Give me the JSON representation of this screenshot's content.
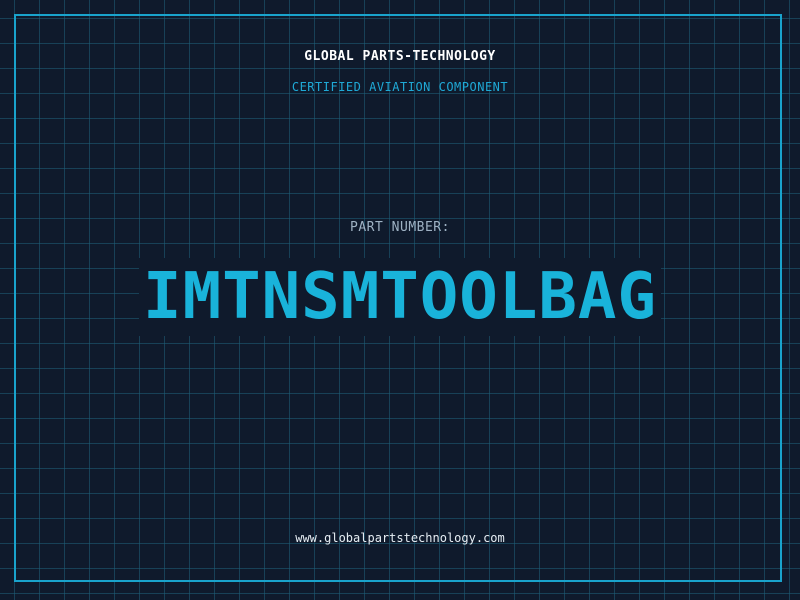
{
  "header": {
    "company": "GLOBAL PARTS-TECHNOLOGY",
    "subtitle": "CERTIFIED AVIATION COMPONENT"
  },
  "part": {
    "label": "PART NUMBER:",
    "number": "IMTNSMTOOLBAG"
  },
  "footer": {
    "url": "www.globalpartstechnology.com"
  },
  "colors": {
    "background": "#0f1a2c",
    "grid": "#1e607a",
    "accent": "#19b3da",
    "border": "#19a3cc"
  }
}
